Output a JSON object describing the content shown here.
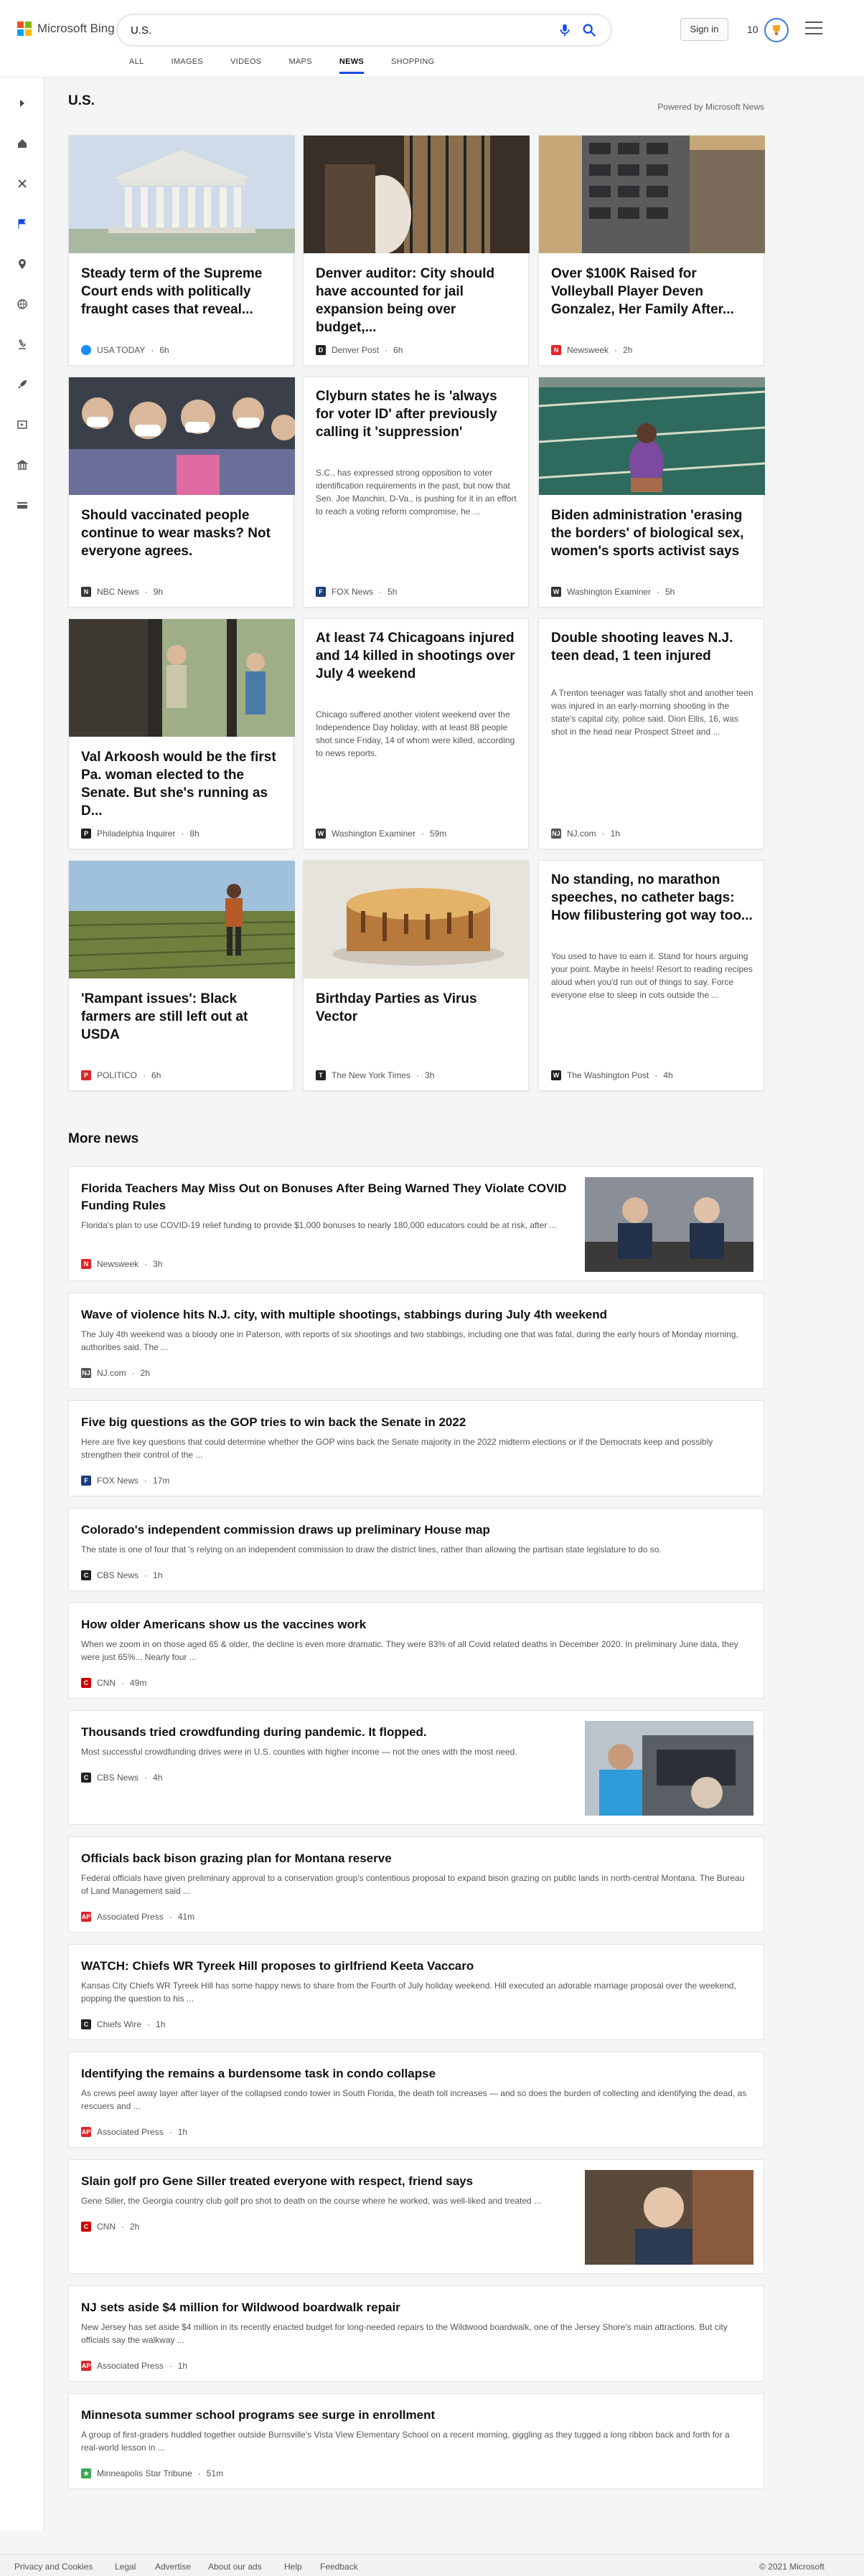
{
  "header": {
    "brand": "Microsoft Bing",
    "query": "U.S.",
    "signin_label": "Sign in",
    "points": "10",
    "tabs": [
      "ALL",
      "IMAGES",
      "VIDEOS",
      "MAPS",
      "NEWS",
      "SHOPPING"
    ],
    "active_tab": "NEWS"
  },
  "section": {
    "title": "U.S.",
    "powered": "Powered by Microsoft News"
  },
  "cards": [
    {
      "title": "Steady term of the Supreme Court ends with politically fraught cases that reveal...",
      "snippet": "",
      "source": "USA TODAY",
      "age": "6h",
      "logo_color": "#1a8cff",
      "image": "supreme-court"
    },
    {
      "title": "Denver auditor: City should have accounted for jail expansion being over budget,...",
      "snippet": "",
      "source": "Denver Post",
      "age": "6h",
      "logo_color": "#222222",
      "image": "jail"
    },
    {
      "title": "Over $100K Raised for Volleyball Player Deven Gonzalez, Her Family After...",
      "snippet": "",
      "source": "Newsweek",
      "age": "2h",
      "logo_color": "#e0232a",
      "image": "building"
    },
    {
      "title": "Should vaccinated people continue to wear masks? Not everyone agrees.",
      "snippet": "",
      "source": "NBC News",
      "age": "9h",
      "logo_color": "#333333",
      "image": "crowd"
    },
    {
      "title": "Clyburn states he is 'always for voter ID' after previously calling it 'suppression'",
      "snippet": "S.C., has expressed strong opposition to voter identification requirements in the past, but now that Sen. Joe Manchin, D-Va., is pushing for it in an effort to reach a voting reform compromise, he ...",
      "source": "FOX News",
      "age": "5h",
      "logo_color": "#1c3c7a",
      "image": ""
    },
    {
      "title": "Biden administration 'erasing the borders' of biological sex, women's sports activist says",
      "snippet": "",
      "source": "Washington Examiner",
      "age": "5h",
      "logo_color": "#333333",
      "image": "pool"
    },
    {
      "title": "Val Arkoosh would be the first Pa. woman elected to the Senate. But she's running as D...",
      "snippet": "",
      "source": "Philadelphia Inquirer",
      "age": "8h",
      "logo_color": "#222222",
      "image": "women"
    },
    {
      "title": "At least 74 Chicagoans injured and 14 killed in shootings over July 4 weekend",
      "snippet": "Chicago suffered another violent weekend over the Independence Day holiday, with at least 88 people shot since Friday, 14 of whom were killed, according to news reports.",
      "source": "Washington Examiner",
      "age": "59m",
      "logo_color": "#333333",
      "image": ""
    },
    {
      "title": "Double shooting leaves N.J. teen dead, 1 teen injured",
      "snippet": "A Trenton teenager was fatally shot and another teen was injured in an early-morning shooting in the state's capital city, police said. Dion Ellis, 16, was shot in the head near Prospect Street and ...",
      "source": "NJ.com",
      "age": "1h",
      "logo_color": "#555555",
      "image": ""
    },
    {
      "title": "'Rampant issues': Black farmers are still left out at USDA",
      "snippet": "",
      "source": "POLITICO",
      "age": "6h",
      "logo_color": "#d9262a",
      "image": "farm"
    },
    {
      "title": "Birthday Parties as Virus Vector",
      "snippet": "",
      "source": "The New York Times",
      "age": "3h",
      "logo_color": "#222222",
      "image": "cake"
    },
    {
      "title": "No standing, no marathon speeches, no catheter bags: How filibustering got way too...",
      "snippet": "You used to have to earn it. Stand for hours arguing your point. Maybe in heels! Resort to reading recipes aloud when you'd run out of things to say. Force everyone else to sleep in cots outside the ...",
      "source": "The Washington Post",
      "age": "4h",
      "logo_color": "#222222",
      "image": ""
    }
  ],
  "more_news": {
    "title": "More news",
    "items": [
      {
        "title": "Florida Teachers May Miss Out on Bonuses After Being Warned They Violate COVID Funding Rules",
        "snippet": "Florida's plan to use COVID-19 relief funding to provide $1,000 bonuses to nearly 180,000 educators could be at risk, after ...",
        "source": "Newsweek",
        "age": "3h",
        "logo_color": "#e0232a",
        "image": "officials"
      },
      {
        "title": "Wave of violence hits N.J. city, with multiple shootings, stabbings during July 4th weekend",
        "snippet": "The July 4th weekend was a bloody one in Paterson, with reports of six shootings and two stabbings, including one that was fatal, during the early hours of Monday morning, authorities said. The ...",
        "source": "NJ.com",
        "age": "2h",
        "logo_color": "#555555",
        "image": ""
      },
      {
        "title": "Five big questions as the GOP tries to win back the Senate in 2022",
        "snippet": "Here are five key questions that could determine whether the GOP wins back the Senate majority in the 2022 midterm elections or if the Democrats keep and possibly strengthen their control of the ...",
        "source": "FOX News",
        "age": "17m",
        "logo_color": "#1c3c7a",
        "image": ""
      },
      {
        "title": "Colorado's independent commission draws up preliminary House map",
        "snippet": "The state is one of four that 's relying on an independent commission to draw the district lines, rather than allowing the partisan state legislature to do so.",
        "source": "CBS News",
        "age": "1h",
        "logo_color": "#222222",
        "image": ""
      },
      {
        "title": "How older Americans show us the vaccines work",
        "snippet": "When we zoom in on those aged 65 & older, the decline is even more dramatic. They were 83% of all Covid related deaths in December 2020. In preliminary June data, they were just 65%... Nearly four ...",
        "source": "CNN",
        "age": "49m",
        "logo_color": "#cc0000",
        "image": ""
      },
      {
        "title": "Thousands tried crowdfunding during pandemic. It flopped.",
        "snippet": "Most successful crowdfunding drives were in U.S. counties with higher income — not the ones with the most need.",
        "source": "CBS News",
        "age": "4h",
        "logo_color": "#222222",
        "image": "car"
      },
      {
        "title": "Officials back bison grazing plan for Montana reserve",
        "snippet": "Federal officials have given preliminary approval to a conservation group's contentious proposal to expand bison grazing on public lands in north-central Montana. The Bureau of Land Management said ...",
        "source": "Associated Press",
        "age": "41m",
        "logo_color": "#d9262a",
        "image": ""
      },
      {
        "title": "WATCH: Chiefs WR Tyreek Hill proposes to girlfriend Keeta Vaccaro",
        "snippet": "Kansas City Chiefs WR Tyreek Hill has some happy news to share from the Fourth of July holiday weekend. Hill executed an adorable marriage proposal over the weekend, popping the question to his ...",
        "source": "Chiefs Wire",
        "age": "1h",
        "logo_color": "#222222",
        "image": ""
      },
      {
        "title": "Identifying the remains a burdensome task in condo collapse",
        "snippet": "As crews peel away layer after layer of the collapsed condo tower in South Florida, the death toll increases — and so does the burden of collecting and identifying the dead, as rescuers and ...",
        "source": "Associated Press",
        "age": "1h",
        "logo_color": "#d9262a",
        "image": ""
      },
      {
        "title": "Slain golf pro Gene Siller treated everyone with respect, friend says",
        "snippet": "Gene Siller, the Georgia country club golf pro shot to death on the course where he worked, was well-liked and treated ...",
        "source": "CNN",
        "age": "2h",
        "logo_color": "#cc0000",
        "image": "portrait"
      },
      {
        "title": "NJ sets aside $4 million for Wildwood boardwalk repair",
        "snippet": "New Jersey has set aside $4 million in its recently enacted budget for long-needed repairs to the Wildwood boardwalk, one of the Jersey Shore's main attractions. But city officials say the walkway ...",
        "source": "Associated Press",
        "age": "1h",
        "logo_color": "#d9262a",
        "image": ""
      },
      {
        "title": "Minnesota summer school programs see surge in enrollment",
        "snippet": "A group of first-graders huddled together outside Burnsville's Vista View Elementary School on a recent morning, giggling as they tugged a long ribbon back and forth for a real-world lesson in ...",
        "source": "Minneapolis Star Tribune",
        "age": "51m",
        "logo_color": "#3aa757",
        "image": ""
      }
    ]
  },
  "footer": {
    "links": [
      "Privacy and Cookies",
      "Legal",
      "Advertise",
      "About our ads",
      "Help",
      "Feedback"
    ],
    "copyright": "© 2021 Microsoft"
  }
}
